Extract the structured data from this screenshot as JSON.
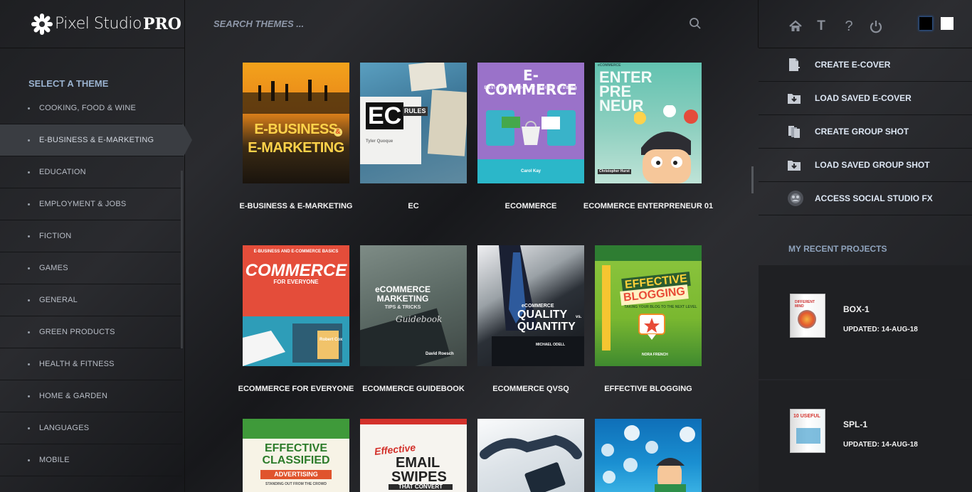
{
  "app": {
    "logo_text": "Pixel Studio",
    "logo_badge": "PRO"
  },
  "search": {
    "placeholder": "SEARCH THEMES ..."
  },
  "top_icons": [
    "home-icon",
    "text-icon",
    "help-icon",
    "power-icon"
  ],
  "color_swatches": [
    {
      "name": "dark",
      "color": "#000000"
    },
    {
      "name": "light",
      "color": "#ffffff"
    }
  ],
  "sidebar": {
    "title": "SELECT A THEME",
    "items": [
      {
        "label": "COOKING, FOOD & WINE"
      },
      {
        "label": "E-BUSINESS & E-MARKETING",
        "active": true
      },
      {
        "label": "EDUCATION"
      },
      {
        "label": "EMPLOYMENT & JOBS"
      },
      {
        "label": "FICTION"
      },
      {
        "label": "GAMES"
      },
      {
        "label": "GENERAL"
      },
      {
        "label": "GREEN PRODUCTS"
      },
      {
        "label": "HEALTH & FITNESS"
      },
      {
        "label": "HOME & GARDEN"
      },
      {
        "label": "LANGUAGES"
      },
      {
        "label": "MOBILE"
      }
    ]
  },
  "themes": [
    {
      "title": "E-BUSINESS & E-MARKETING",
      "cover_text": [
        "E-BUSINESS",
        "&",
        "E-MARKETING"
      ],
      "cover_subtext": ""
    },
    {
      "title": "EC",
      "cover_text": [
        "EC",
        "RULES"
      ],
      "cover_subtext": "Tyler Quoque"
    },
    {
      "title": "ECOMMERCE",
      "cover_text": [
        "E-COMMERCE"
      ],
      "cover_subtext": "Basic Principles of Online Trading",
      "cover_author": "Carol Kay"
    },
    {
      "title": "ECOMMERCE ENTERPRENEUR 01",
      "cover_text": [
        "ENTER",
        "PRE",
        "NEUR"
      ],
      "cover_subtext": "eCOMMERCE",
      "cover_author": "Christopher Hurst"
    },
    {
      "title": "ECOMMERCE FOR EVERYONE",
      "cover_text": [
        "COMMERCE",
        "FOR EVERYONE"
      ],
      "cover_subtext": "E-BUSINESS AND E-COMMERCE BASICS",
      "cover_author": "Robert Cox"
    },
    {
      "title": "ECOMMERCE GUIDEBOOK",
      "cover_text": [
        "eCOMMERCE",
        "MARKETING",
        "TIPS & TRICKS",
        "Guidebook"
      ],
      "cover_author": "David Roesch"
    },
    {
      "title": "ECOMMERCE QVSQ",
      "cover_text": [
        "eCOMMERCE",
        "QUALITY",
        "vs.",
        "QUANTITY"
      ],
      "cover_author": "MICHAEL ODELL"
    },
    {
      "title": "EFFECTIVE BLOGGING",
      "cover_text": [
        "EFFECTIVE",
        "BLOGGING"
      ],
      "cover_subtext": "TAKING YOUR BLOG TO THE NEXT LEVEL",
      "cover_author": "NORA FRENCH"
    },
    {
      "title": "",
      "cover_text": [
        "EFFECTIVE",
        "CLASSIFIED",
        "ADVERTISING"
      ],
      "cover_subtext": "STANDING OUT FROM THE CROWD"
    },
    {
      "title": "",
      "cover_text": [
        "Effective",
        "EMAIL",
        "SWIPES",
        "THAT CONVERT"
      ]
    },
    {
      "title": "",
      "cover_text": []
    },
    {
      "title": "",
      "cover_text": []
    }
  ],
  "actions": [
    {
      "label": "CREATE E-COVER",
      "icon": "create-file-icon"
    },
    {
      "label": "LOAD SAVED E-COVER",
      "icon": "load-folder-icon"
    },
    {
      "label": "CREATE GROUP SHOT",
      "icon": "group-shot-icon"
    },
    {
      "label": "LOAD SAVED GROUP SHOT",
      "icon": "load-folder-icon"
    },
    {
      "label": "ACCESS SOCIAL STUDIO FX",
      "icon": "social-studio-icon"
    }
  ],
  "recent": {
    "title": "MY RECENT PROJECTS",
    "items": [
      {
        "name": "BOX-1",
        "updated": "UPDATED: 14-AUG-18",
        "thumb_text": "DIFFERENT MIND"
      },
      {
        "name": "SPL-1",
        "updated": "UPDATED: 14-AUG-18",
        "thumb_text": "10 USEFUL"
      }
    ]
  }
}
